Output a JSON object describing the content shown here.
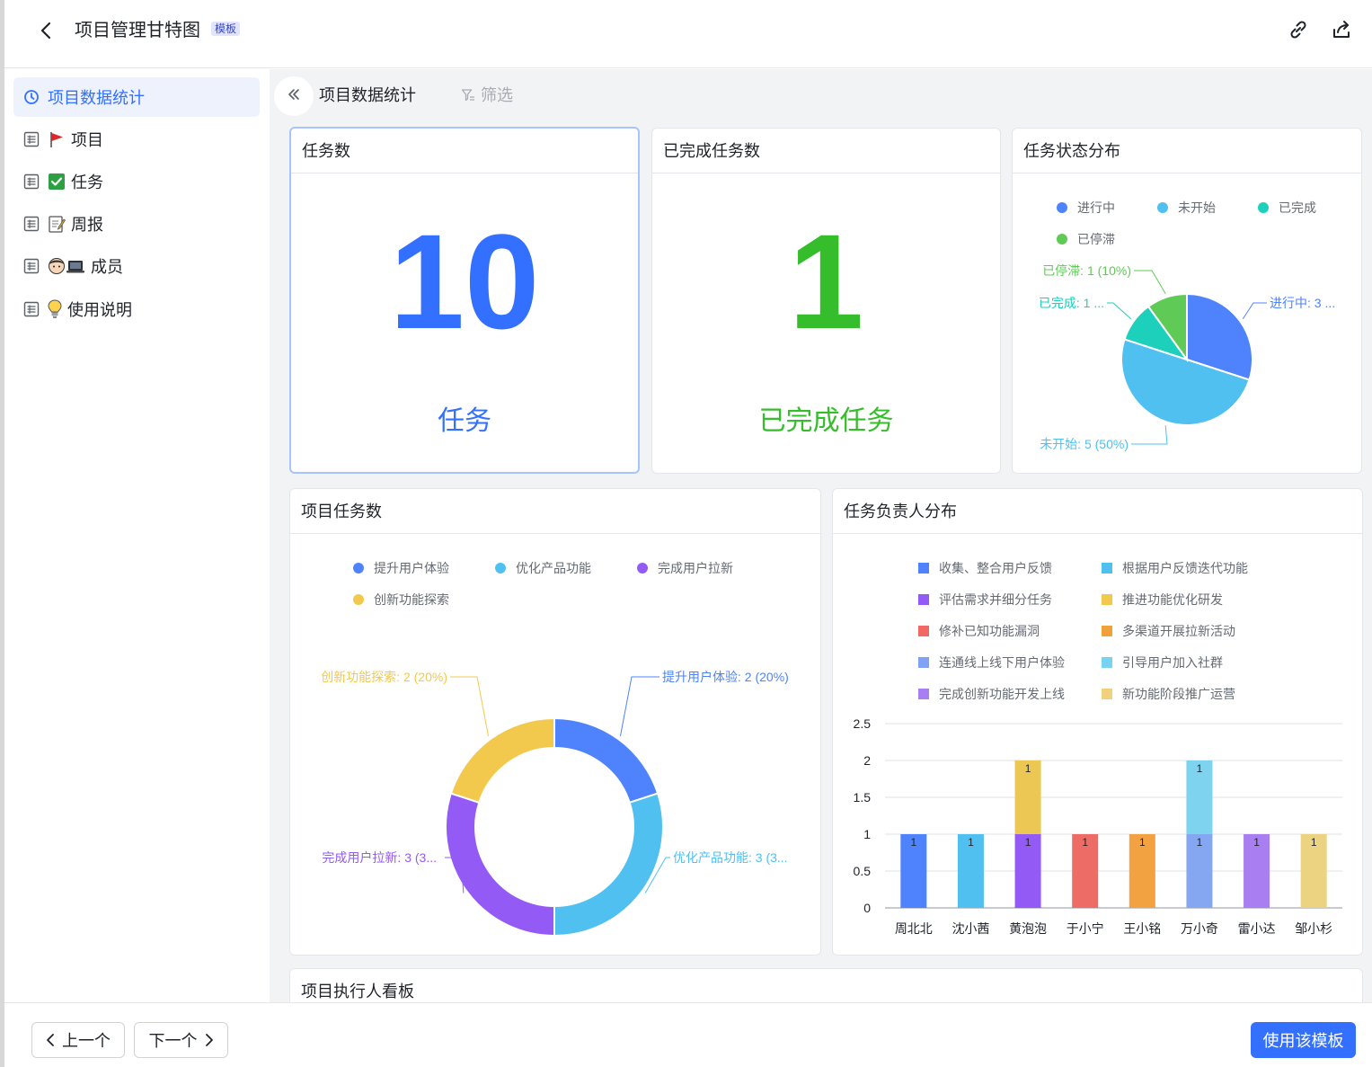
{
  "header": {
    "title": "项目管理甘特图",
    "badge": "模板"
  },
  "sidebar": {
    "items": [
      {
        "label": "项目数据统计",
        "emoji": "",
        "active": true
      },
      {
        "label": "项目",
        "emoji": "🚩"
      },
      {
        "label": "任务",
        "emoji": "✅"
      },
      {
        "label": "周报",
        "emoji": "📝"
      },
      {
        "label": "成员",
        "emoji": "🧑‍💻"
      },
      {
        "label": "使用说明",
        "emoji": "💡"
      }
    ]
  },
  "main": {
    "title": "项目数据统计",
    "filter_label": "筛选"
  },
  "cards": {
    "task_count": {
      "title": "任务数",
      "value": "10",
      "subtitle": "任务",
      "color": "#3370ff"
    },
    "done_count": {
      "title": "已完成任务数",
      "value": "1",
      "subtitle": "已完成任务",
      "color": "#35bd4b"
    },
    "status_dist": {
      "title": "任务状态分布"
    },
    "project_tasks": {
      "title": "项目任务数"
    },
    "assignee_dist": {
      "title": "任务负责人分布"
    },
    "board": {
      "title": "项目执行人看板"
    }
  },
  "footer": {
    "prev_label": "上一个",
    "next_label": "下一个",
    "use_label": "使用该模板"
  },
  "chart_data": [
    {
      "type": "pie",
      "legend": [
        {
          "name": "进行中",
          "color": "#4e83fd"
        },
        {
          "name": "未开始",
          "color": "#50c0f0"
        },
        {
          "name": "已完成",
          "color": "#1cd0bb"
        },
        {
          "name": "已停滞",
          "color": "#5fca55"
        }
      ],
      "slices": [
        {
          "name": "进行中",
          "value": 3,
          "color": "#4e83fd",
          "label": "进行中: 3 ..."
        },
        {
          "name": "未开始",
          "value": 5,
          "color": "#50c0f0",
          "label": "未开始: 5 (50%)"
        },
        {
          "name": "已完成",
          "value": 1,
          "color": "#1cd0bb",
          "label": "已完成: 1 ..."
        },
        {
          "name": "已停滞",
          "value": 1,
          "color": "#5fca55",
          "label": "已停滞: 1 (10%)"
        }
      ]
    },
    {
      "type": "pie",
      "donut": true,
      "legend": [
        {
          "name": "提升用户体验",
          "color": "#4e83fd"
        },
        {
          "name": "优化产品功能",
          "color": "#50c0f0"
        },
        {
          "name": "完成用户拉新",
          "color": "#935af6"
        },
        {
          "name": "创新功能探索",
          "color": "#f2c94c"
        }
      ],
      "slices": [
        {
          "name": "提升用户体验",
          "value": 2,
          "color": "#4e83fd",
          "label": "提升用户体验: 2 (20%)"
        },
        {
          "name": "优化产品功能",
          "value": 3,
          "color": "#50c0f0",
          "label": "优化产品功能: 3 (3..."
        },
        {
          "name": "完成用户拉新",
          "value": 3,
          "color": "#935af6",
          "label": "完成用户拉新: 3 (3..."
        },
        {
          "name": "创新功能探索",
          "value": 2,
          "color": "#f2c94c",
          "label": "创新功能探索: 2 (20%)"
        }
      ]
    },
    {
      "type": "bar",
      "stacked": true,
      "categories": [
        "周北北",
        "沈小茜",
        "黄泡泡",
        "于小宁",
        "王小铭",
        "万小奇",
        "雷小达",
        "邹小杉"
      ],
      "ylim": [
        0,
        2.5
      ],
      "yticks": [
        "0",
        "0.5",
        "1",
        "1.5",
        "2",
        "2.5"
      ],
      "legend": [
        {
          "name": "收集、整合用户反馈",
          "color": "#4e83fd"
        },
        {
          "name": "根据用户反馈迭代功能",
          "color": "#50c0f0"
        },
        {
          "name": "评估需求并细分任务",
          "color": "#935af6"
        },
        {
          "name": "推进功能优化研发",
          "color": "#f2c94c"
        },
        {
          "name": "修补已知功能漏洞",
          "color": "#f26964"
        },
        {
          "name": "多渠道开展拉新活动",
          "color": "#f2a03a"
        },
        {
          "name": "连通线上线下用户体验",
          "color": "#7fa2f5"
        },
        {
          "name": "引导用户加入社群",
          "color": "#78d3f2"
        },
        {
          "name": "完成创新功能开发上线",
          "color": "#a97ef0"
        },
        {
          "name": "新功能阶段推广运营",
          "color": "#f0d27e"
        }
      ],
      "bars": [
        [
          {
            "series": "收集、整合用户反馈",
            "value": 1,
            "color": "#4e83fd",
            "label": "1"
          }
        ],
        [
          {
            "series": "根据用户反馈迭代功能",
            "value": 1,
            "color": "#50c0f0",
            "label": "1"
          }
        ],
        [
          {
            "series": "评估需求并细分任务",
            "value": 1,
            "color": "#935af6",
            "label": "1"
          },
          {
            "series": "推进功能优化研发",
            "value": 1,
            "color": "#ecc753",
            "label": "1"
          }
        ],
        [
          {
            "series": "修补已知功能漏洞",
            "value": 1,
            "color": "#ed6d66",
            "label": "1"
          }
        ],
        [
          {
            "series": "多渠道开展拉新活动",
            "value": 1,
            "color": "#f2a241",
            "label": "1"
          }
        ],
        [
          {
            "series": "连通线上线下用户体验",
            "value": 1,
            "color": "#85a7f2",
            "label": "1"
          },
          {
            "series": "引导用户加入社群",
            "value": 1,
            "color": "#7ed3ef",
            "label": "1"
          }
        ],
        [
          {
            "series": "完成创新功能开发上线",
            "value": 1,
            "color": "#a97ef0",
            "label": "1"
          }
        ],
        [
          {
            "series": "新功能阶段推广运营",
            "value": 1,
            "color": "#ecd382",
            "label": "1"
          }
        ]
      ]
    }
  ]
}
